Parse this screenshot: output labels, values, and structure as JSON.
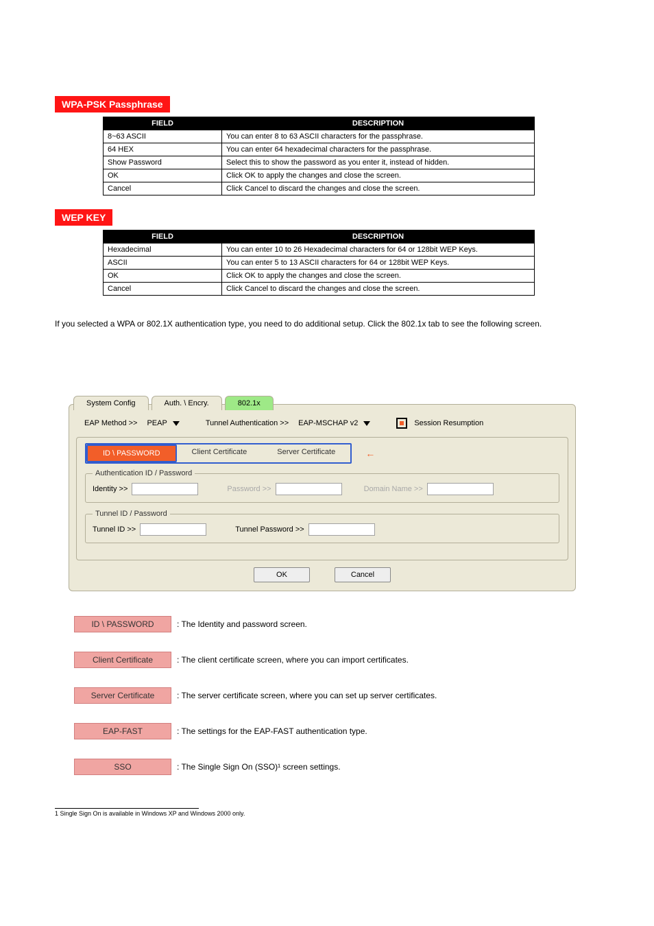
{
  "sections": {
    "pass": {
      "title": "WPA-PSK Passphrase",
      "table": {
        "headers": [
          "FIELD",
          "DESCRIPTION"
        ],
        "rows": [
          [
            "8~63 ASCII",
            "You can enter 8 to 63 ASCII characters for the passphrase."
          ],
          [
            "64 HEX",
            "You can enter 64 hexadecimal characters for the passphrase."
          ],
          [
            "Show Password",
            "Select this to show the password as you enter it, instead of hidden."
          ],
          [
            "OK",
            "Click OK to apply the changes and close the screen."
          ],
          [
            "Cancel",
            "Click Cancel to discard the changes and close the screen."
          ]
        ]
      }
    },
    "wep": {
      "title": "WEP KEY",
      "table": {
        "headers": [
          "FIELD",
          "DESCRIPTION"
        ],
        "rows": [
          [
            "Hexadecimal",
            "You can enter 10 to 26 Hexadecimal characters for 64 or 128bit WEP Keys."
          ],
          [
            "ASCII",
            "You can enter 5 to 13 ASCII characters for 64 or 128bit WEP Keys."
          ],
          [
            "OK",
            "Click OK to apply the changes and close the screen."
          ],
          [
            "Cancel",
            "Click Cancel to discard the changes and close the screen."
          ]
        ]
      }
    }
  },
  "intro": "If you selected a WPA or 802.1X authentication type, you need to do additional setup. Click the 802.1x tab to see the following screen.",
  "panel": {
    "tabs": [
      "System Config",
      "Auth. \\ Encry.",
      "802.1x"
    ],
    "active_tab": 2,
    "eap_method_label": "EAP Method >>",
    "eap_method_value": "PEAP",
    "tunnel_auth_label": "Tunnel Authentication >>",
    "tunnel_auth_value": "EAP-MSCHAP v2",
    "session_resumption_label": "Session Resumption",
    "sub_tabs": [
      "ID \\ PASSWORD",
      "Client Certificate",
      "Server Certificate"
    ],
    "group1": {
      "legend": "Authentication ID / Password",
      "identity_label": "Identity >>",
      "password_label": "Password >>",
      "domain_label": "Domain Name >>"
    },
    "group2": {
      "legend": "Tunnel ID / Password",
      "id_label": "Tunnel ID >>",
      "pw_label": "Tunnel Password >>"
    },
    "ok_label": "OK",
    "cancel_label": "Cancel"
  },
  "pink_buttons": [
    {
      "label": "ID \\ PASSWORD",
      "desc": ": The Identity and password screen."
    },
    {
      "label": "Client Certificate",
      "desc": ": The client certificate screen, where you can import certificates."
    },
    {
      "label": "Server Certificate",
      "desc": ": The server certificate screen, where you can set up server certificates."
    },
    {
      "label": "EAP-FAST",
      "desc": ": The settings for the EAP-FAST authentication type."
    },
    {
      "label": "SSO",
      "desc": ": The Single Sign On (SSO)¹ screen settings."
    }
  ],
  "footnote": "1 Single Sign On is available in Windows XP and Windows 2000 only."
}
